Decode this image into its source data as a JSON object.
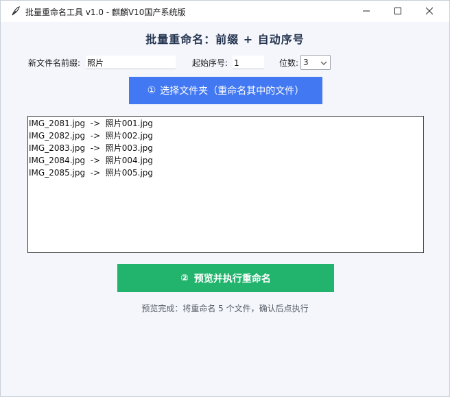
{
  "window": {
    "title": "批量重命名工具  v1.0  -  麒麟V10国产系统版",
    "controls": {
      "minimize_icon": "minimize-icon",
      "maximize_icon": "maximize-icon",
      "close_icon": "close-icon"
    }
  },
  "heading": "批量重命名：前缀  +  自动序号",
  "form": {
    "prefix_label": "新文件名前缀:",
    "prefix_value": "照片",
    "start_label": "起始序号:",
    "start_value": "1",
    "digits_label": "位数:",
    "digits_value": "3"
  },
  "select_folder_button": {
    "icon": "①",
    "label": "选择文件夹（重命名其中的文件）"
  },
  "preview_list": [
    "IMG_2081.jpg  ->  照片001.jpg",
    "IMG_2082.jpg  ->  照片002.jpg",
    "IMG_2083.jpg  ->  照片003.jpg",
    "IMG_2084.jpg  ->  照片004.jpg",
    "IMG_2085.jpg  ->  照片005.jpg"
  ],
  "execute_button": {
    "icon": "②",
    "label": "预览并执行重命名"
  },
  "status": "预览完成：将重命名 5 个文件，确认后点执行",
  "colors": {
    "primary_blue": "#4278f1",
    "primary_green": "#22b46d",
    "heading": "#24344f"
  }
}
